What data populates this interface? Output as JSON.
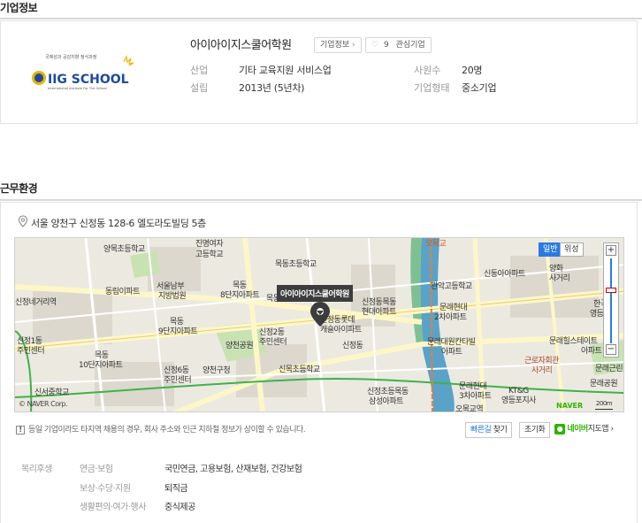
{
  "company_section": {
    "title": "기업정보",
    "logo_text": "IIG SCHOOL",
    "logo_caption": "국제성과 공감지향 정식과정",
    "logo_subcaption": "International Institute For The School",
    "company_name": "아이아이지스쿨어학원",
    "info_button": "기업정보",
    "interest_count": "9",
    "interest_label": "관심기업",
    "fields": [
      {
        "label": "산업",
        "value": "기타 교육지원 서비스업"
      },
      {
        "label": "설립",
        "value": "2013년 (5년차)"
      },
      {
        "label": "사원수",
        "value": "20명"
      },
      {
        "label": "기업형태",
        "value": "중소기업"
      }
    ]
  },
  "environment_section": {
    "title": "근무환경",
    "address": "서울 양천구 신정동 128-6 엘도라도빌딩 5층",
    "map": {
      "marker_label": "아이아이지스쿨어학원",
      "type_general": "일반",
      "type_satellite": "위성",
      "zoom_in": "+",
      "zoom_out": "−",
      "brand": "NAVER",
      "scale": "200m",
      "copyright": "© NAVER Corp.",
      "labels": [
        "양목초등학교",
        "진명여자",
        "고등학교",
        "동림이파트",
        "서울남부",
        "지방법원",
        "목동",
        "8단지아파트",
        "목동초등학교",
        "목동중학교",
        "오목교",
        "관악고등학교",
        "신동아아파트",
        "양화",
        "사거리",
        "신정네거리역",
        "목동",
        "9단지아파트",
        "신정2동",
        "주민센터",
        "신정동롯데",
        "캐슬아이파트",
        "신정동목동",
        "현대아파트",
        "문래현대",
        "2차아파트",
        "한국전",
        "영등포",
        "신정1동",
        "주민센터",
        "양천공원",
        "목동",
        "10단지아파트",
        "신정6동",
        "주민센터",
        "양천구청",
        "신목초등학교",
        "문래대원칸타빌",
        "아파트",
        "문래힐스테이트",
        "아파트",
        "문래근린",
        "근로자회관",
        "사거리",
        "신서중학교",
        "신정초등목동",
        "삼성아파트",
        "문래현대",
        "3차아파트",
        "KT&G",
        "영등포지사",
        "오목교역",
        "신정동",
        "문래공원"
      ]
    },
    "notice": "등일 기업이라도 타지역 채용의 경우, 회사 주소와 인근 지하철 정보가 상이할 수 있습니다.",
    "buttons": {
      "directions_blue": "빠른길",
      "directions_rest": " 찾기",
      "reset": "초기화",
      "naver_map_green": "네이버",
      "naver_map_rest": "지도앱"
    },
    "welfare": {
      "category": "복리후생",
      "rows": [
        {
          "label": "연금·보험",
          "value": "국민연금, 고용보험, 산재보험, 건강보험"
        },
        {
          "label": "보상·수당·지원",
          "value": "퇴직금"
        },
        {
          "label": "생활편의·여가·행사",
          "value": "중식제공"
        }
      ]
    }
  },
  "colors": {
    "accent_blue": "#2a7ae2",
    "naver_green": "#2db400",
    "river": "#5aa2c8",
    "park": "#c9e2b4"
  }
}
